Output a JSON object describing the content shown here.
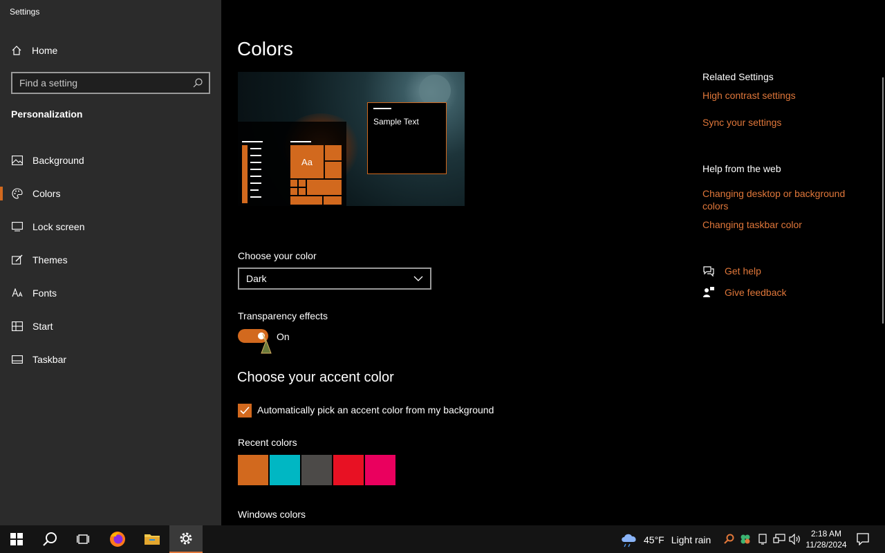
{
  "window": {
    "title": "Settings"
  },
  "sidebar": {
    "home_label": "Home",
    "search_placeholder": "Find a setting",
    "section_title": "Personalization",
    "items": [
      {
        "label": "Background",
        "icon": "picture-icon"
      },
      {
        "label": "Colors",
        "icon": "palette-icon",
        "active": true
      },
      {
        "label": "Lock screen",
        "icon": "lock-screen-icon"
      },
      {
        "label": "Themes",
        "icon": "brush-icon"
      },
      {
        "label": "Fonts",
        "icon": "font-icon"
      },
      {
        "label": "Start",
        "icon": "start-grid-icon"
      },
      {
        "label": "Taskbar",
        "icon": "taskbar-icon"
      }
    ]
  },
  "main": {
    "title": "Colors",
    "preview": {
      "sample_text": "Sample Text",
      "tile_text": "Aa"
    },
    "choose_color_label": "Choose your color",
    "choose_color_value": "Dark",
    "transparency_label": "Transparency effects",
    "transparency_state": "On",
    "accent_heading": "Choose your accent color",
    "auto_pick_label": "Automatically pick an accent color from my background",
    "recent_colors_label": "Recent colors",
    "recent_colors": [
      "#d2691e",
      "#00b7c3",
      "#4c4a48",
      "#e81123",
      "#ea005e"
    ],
    "windows_colors_label": "Windows colors"
  },
  "related": {
    "heading": "Related Settings",
    "links": [
      "High contrast settings",
      "Sync your settings"
    ],
    "help_heading": "Help from the web",
    "help_links": [
      "Changing desktop or background colors",
      "Changing taskbar color"
    ],
    "get_help": "Get help",
    "give_feedback": "Give feedback"
  },
  "taskbar": {
    "weather_temp": "45°F",
    "weather_desc": "Light rain",
    "time": "2:18 AM",
    "date": "11/28/2024"
  },
  "colors": {
    "accent": "#d2691e",
    "link": "#e0773a",
    "sidebar_bg": "#2b2b2b"
  }
}
